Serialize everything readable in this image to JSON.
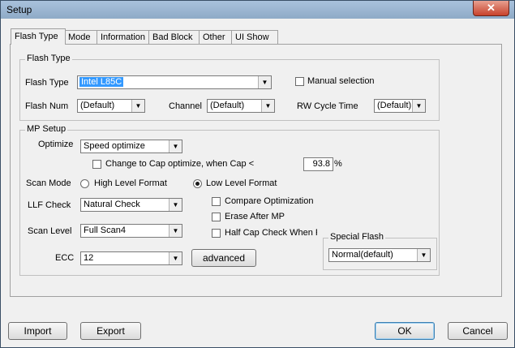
{
  "window": {
    "title": "Setup",
    "close_symbol": "✕"
  },
  "tabs": [
    "Flash Type",
    "Mode",
    "Information",
    "Bad Block",
    "Other",
    "UI Show"
  ],
  "flash_type_group": {
    "title": "Flash Type",
    "flash_type_label": "Flash Type",
    "flash_type_value": "Intel L85C",
    "manual_selection_label": "Manual selection",
    "flash_num_label": "Flash Num",
    "flash_num_value": "(Default)",
    "channel_label": "Channel",
    "channel_value": "(Default)",
    "rw_cycle_label": "RW Cycle Time",
    "rw_cycle_value": "(Default)"
  },
  "mp_setup": {
    "title": "MP Setup",
    "optimize_label": "Optimize",
    "optimize_value": "Speed optimize",
    "cap_optimize_label": "Change to Cap optimize, when Cap  <",
    "cap_value": "93.8",
    "cap_unit": "%",
    "scan_mode_label": "Scan Mode",
    "high_level_label": "High Level Format",
    "low_level_label": "Low Level Format",
    "llf_check_label": "LLF Check",
    "llf_check_value": "Natural Check",
    "compare_opt_label": "Compare Optimization",
    "erase_after_label": "Erase After MP",
    "half_cap_label": "Half Cap Check When F",
    "scan_level_label": "Scan Level",
    "scan_level_value": "Full Scan4",
    "ecc_label": "ECC",
    "ecc_value": "12",
    "advanced_label": "advanced",
    "special_flash_title": "Special Flash",
    "special_flash_value": "Normal(default)"
  },
  "footer": {
    "import": "Import",
    "export": "Export",
    "ok": "OK",
    "cancel": "Cancel"
  }
}
